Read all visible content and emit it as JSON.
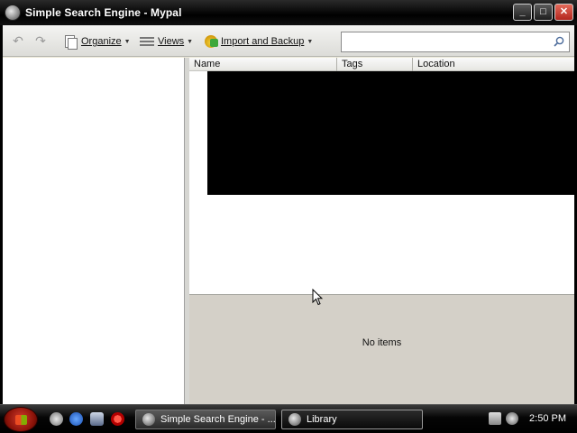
{
  "window": {
    "title": "Simple Search Engine - Mypal",
    "controls": {
      "minimize": "_",
      "maximize": "□",
      "close": "✕"
    }
  },
  "toolbar": {
    "back_icon": "back-arrow-icon",
    "forward_icon": "forward-arrow-icon",
    "organize_label": "Organize",
    "views_label": "Views",
    "import_backup_label": "Import and Backup",
    "search": {
      "value": "",
      "placeholder": ""
    }
  },
  "list": {
    "columns": [
      "Name",
      "Tags",
      "Location"
    ]
  },
  "details": {
    "status": "No items"
  },
  "taskbar": {
    "tasks": [
      {
        "label": "Simple Search Engine - ..."
      },
      {
        "label": "Library"
      }
    ],
    "clock": "2:50 PM"
  }
}
